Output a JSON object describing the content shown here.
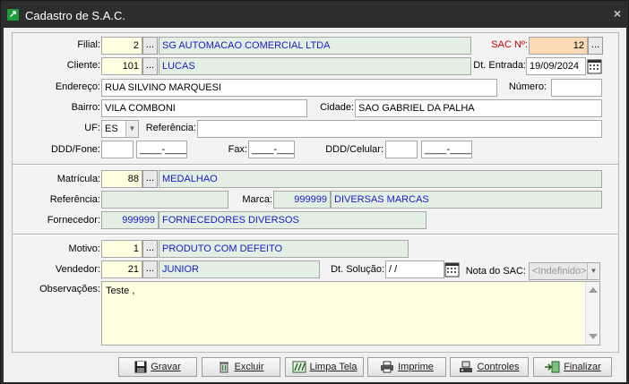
{
  "window": {
    "title": "Cadastro de S.A.C.",
    "close": "×"
  },
  "form": {
    "filial": {
      "label": "Filial:",
      "code": "2",
      "name": "SG AUTOMACAO COMERCIAL LTDA"
    },
    "sac": {
      "label": "SAC  Nº:",
      "value": "12"
    },
    "cliente": {
      "label": "Cliente:",
      "code": "101",
      "name": "LUCAS"
    },
    "dt_entrada": {
      "label": "Dt. Entrada:",
      "value": "19/09/2024"
    },
    "endereco": {
      "label": "Endereço:",
      "value": "RUA SILVINO MARQUESI"
    },
    "numero": {
      "label": "Número:",
      "value": ""
    },
    "bairro": {
      "label": "Bairro:",
      "value": "VILA COMBONI"
    },
    "cidade": {
      "label": "Cidade:",
      "value": "SAO GABRIEL DA PALHA"
    },
    "uf": {
      "label": "UF:",
      "value": "ES"
    },
    "referencia": {
      "label": "Referência:",
      "value": ""
    },
    "ddd_fone": {
      "label": "DDD/Fone:",
      "ddd": "",
      "number": "____-____"
    },
    "fax": {
      "label": "Fax:",
      "number": "____-____"
    },
    "ddd_celular": {
      "label": "DDD/Celular:",
      "ddd": "",
      "number": "____-____"
    },
    "matricula": {
      "label": "Matrícula:",
      "code": "88",
      "name": "MEDALHAO"
    },
    "referencia2": {
      "label": "Referência:",
      "value": ""
    },
    "marca": {
      "label": "Marca:",
      "code": "999999",
      "name": "DIVERSAS MARCAS"
    },
    "fornecedor": {
      "label": "Fornecedor:",
      "code": "999999",
      "name": "FORNECEDORES DIVERSOS"
    },
    "motivo": {
      "label": "Motivo:",
      "code": "1",
      "name": "PRODUTO COM DEFEITO"
    },
    "vendedor": {
      "label": "Vendedor:",
      "code": "21",
      "name": "JUNIOR"
    },
    "dt_solucao": {
      "label": "Dt. Solução:",
      "value": " / /"
    },
    "nota_sac": {
      "label": "Nota do SAC:",
      "value": "<Indefinido>"
    },
    "observacoes": {
      "label": "Observações:",
      "value": "Teste ,"
    },
    "lookup_button": "..."
  },
  "buttons": {
    "gravar": "Gravar",
    "excluir": "Excluir",
    "limpa_tela": "Limpa Tela",
    "imprime": "Imprime",
    "controles": "Controles",
    "finalizar": "Finalizar"
  },
  "icons": {
    "app": "app-logo-icon",
    "calendar": "calendar-icon",
    "dropdown": "chevron-down-icon",
    "save": "floppy-disk-icon",
    "delete": "trash-icon",
    "clear": "eraser-icon",
    "print": "printer-icon",
    "controls": "gear-icon",
    "exit": "door-exit-icon"
  },
  "colors": {
    "titlebar": "#2d2d2d",
    "yellow_field": "#ffffe1",
    "green_field": "#e3efe3",
    "orange_field": "#fcd9b3",
    "sac_label": "#cc0000",
    "lookup_text": "#1a1acc"
  }
}
